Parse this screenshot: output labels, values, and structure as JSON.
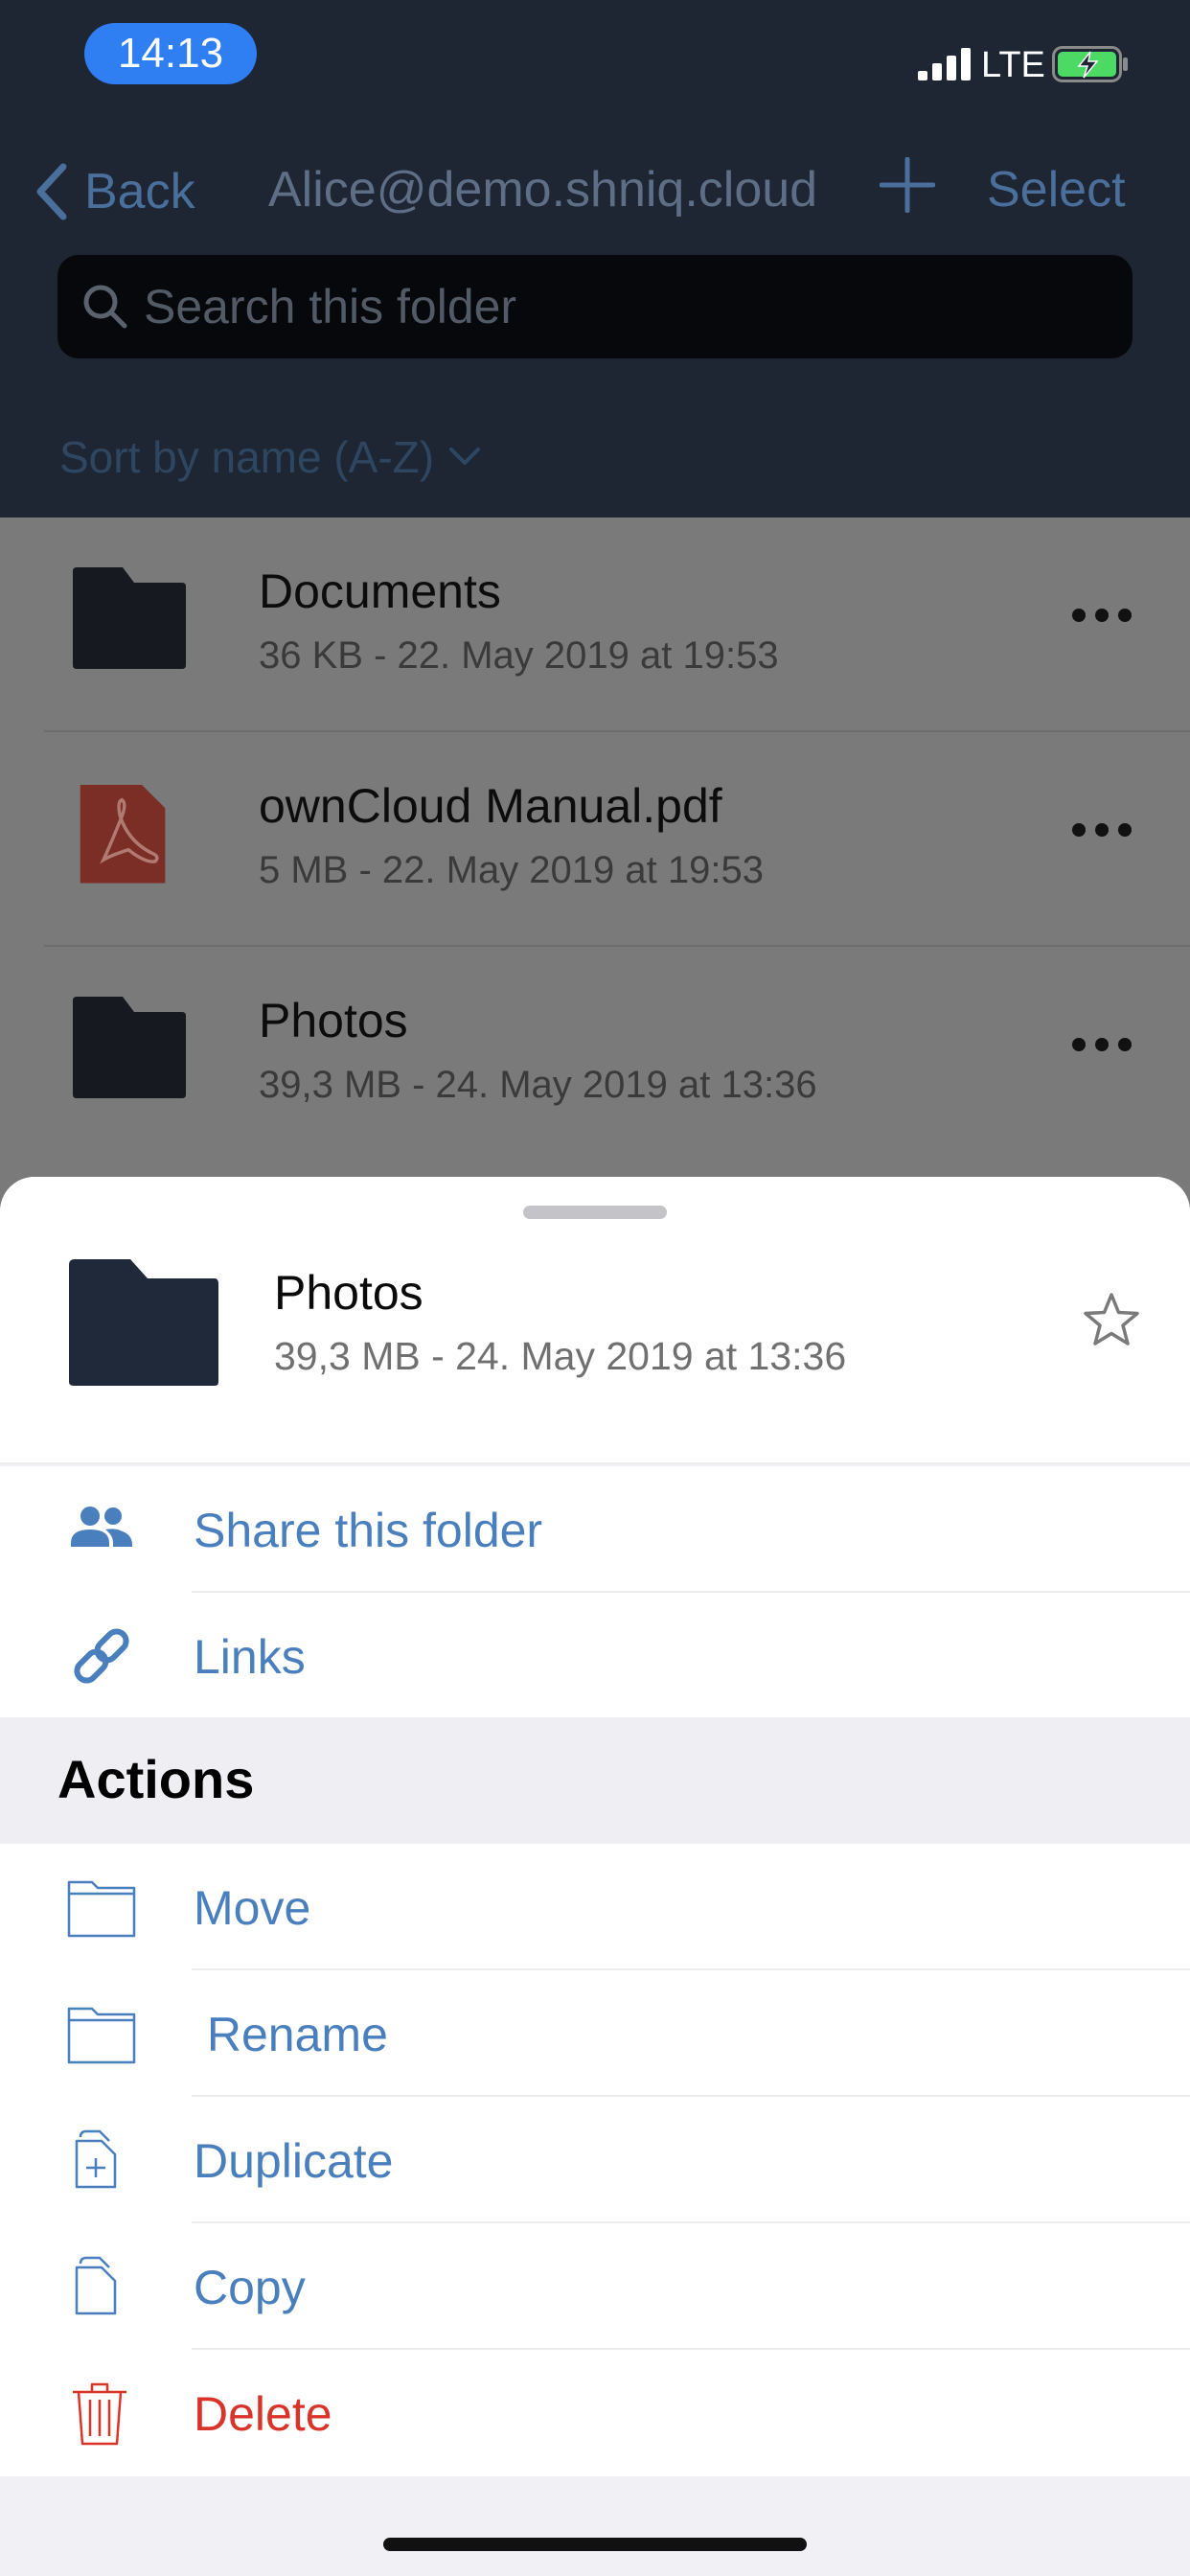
{
  "status_bar": {
    "time": "14:13",
    "network": "LTE",
    "signal_bars": 4,
    "battery_charging": true,
    "battery_color": "#4cd964"
  },
  "nav": {
    "back_label": "Back",
    "title": "Alice@demo.shniq.cloud",
    "select_label": "Select"
  },
  "search": {
    "placeholder": "Search this folder"
  },
  "sort": {
    "label": "Sort by name (A-Z)"
  },
  "files": [
    {
      "name": "Documents",
      "meta": "36 KB - 22. May 2019 at 19:53",
      "icon": "folder-icon"
    },
    {
      "name": "ownCloud Manual.pdf",
      "meta": "5 MB - 22. May 2019 at 19:53",
      "icon": "pdf-icon"
    },
    {
      "name": "Photos",
      "meta": "39,3 MB - 24. May 2019 at 13:36",
      "icon": "folder-icon"
    }
  ],
  "sheet": {
    "item_name": "Photos",
    "item_meta": "39,3 MB - 24. May 2019 at 13:36",
    "share_actions": [
      {
        "label": "Share this folder",
        "icon": "people-icon"
      },
      {
        "label": "Links",
        "icon": "link-icon"
      }
    ],
    "actions_title": "Actions",
    "actions": [
      {
        "label": "Move",
        "icon": "folder-outline-icon"
      },
      {
        "label": " Rename",
        "icon": "folder-outline-icon"
      },
      {
        "label": "Duplicate",
        "icon": "duplicate-icon"
      },
      {
        "label": "Copy",
        "icon": "copy-icon"
      },
      {
        "label": "Delete",
        "icon": "trash-icon"
      }
    ]
  },
  "colors": {
    "accent": "#4a7fbd",
    "danger": "#d9342a",
    "header_bg": "#1e2533",
    "time_pill": "#2f7ff2"
  }
}
